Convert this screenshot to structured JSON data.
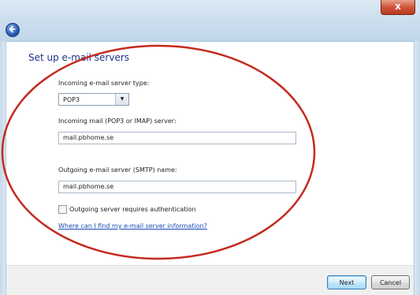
{
  "window": {
    "close_label": "x"
  },
  "nav": {
    "back_icon": "back-arrow-icon"
  },
  "form": {
    "title": "Set up e-mail servers",
    "incoming_type_label": "Incoming e-mail server type:",
    "incoming_type_value": "POP3",
    "incoming_server_label": "Incoming mail (POP3 or IMAP) server:",
    "incoming_server_value": "mail.pbhome.se",
    "outgoing_server_label": "Outgoing e-mail server (SMTP) name:",
    "outgoing_server_value": "mail.pbhome.se",
    "auth_checkbox_label": "Outgoing server requires authentication",
    "auth_checked": false,
    "help_link": "Where can I find my e-mail server information?"
  },
  "buttons": {
    "next": "Next",
    "cancel": "Cancel"
  },
  "colors": {
    "annotation_circle": "#c42a1f",
    "title_text": "#1e3287",
    "link_text": "#1a48b8"
  }
}
